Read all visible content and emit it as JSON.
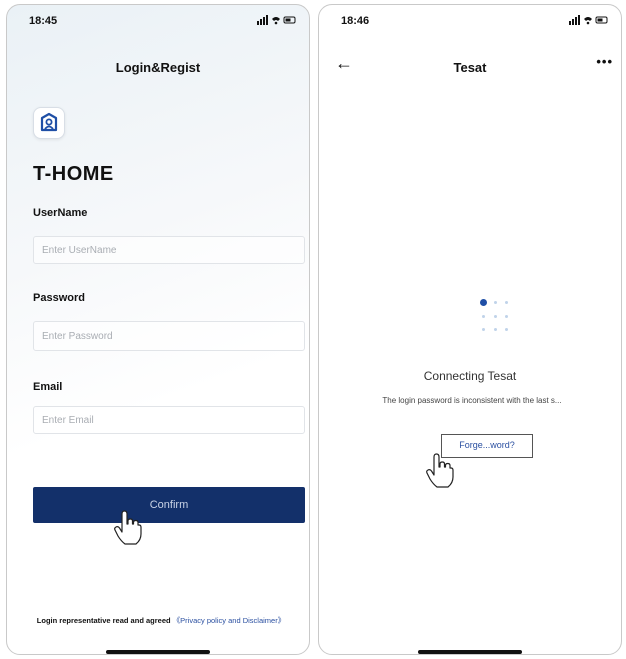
{
  "left_screen": {
    "status": {
      "time": "18:45",
      "icons": "signal-wifi-battery"
    },
    "title": "Login&Regist",
    "brand": "T-HOME",
    "fields": [
      {
        "label": "UserName",
        "placeholder": "Enter UserName"
      },
      {
        "label": "Password",
        "placeholder": "Enter Password"
      },
      {
        "label": "Email",
        "placeholder": "Enter Email"
      }
    ],
    "confirm_label": "Confirm",
    "agreement": {
      "text": "Login representative read and agreed",
      "link": "《Privacy policy and Disclaimer》"
    }
  },
  "right_screen": {
    "status": {
      "time": "18:46",
      "icons": "signal-wifi-battery"
    },
    "title": "Tesat",
    "more": "•••",
    "connecting": "Connecting Tesat",
    "message": "The login password is inconsistent with the last s...",
    "forgot_label": "Forge...word?"
  },
  "colors": {
    "primary": "#13306a",
    "accent": "#1f4fa6",
    "link": "#2a4fa0"
  }
}
